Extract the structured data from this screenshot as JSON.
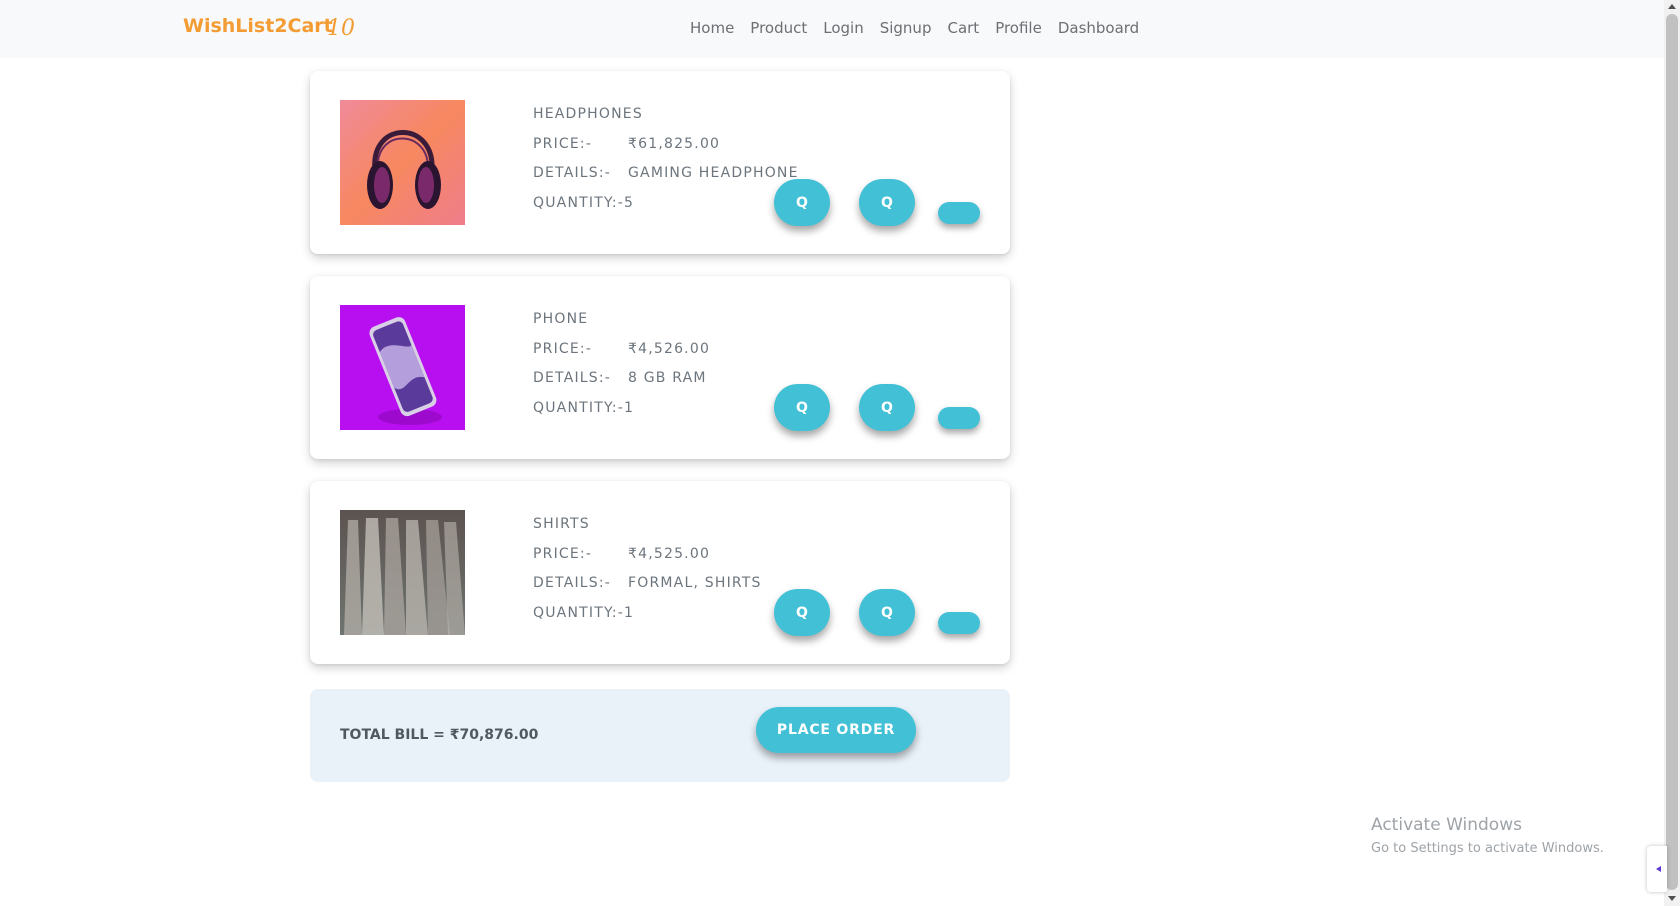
{
  "navbar": {
    "brand": "WishList2Cart",
    "cart_count": "10",
    "links": [
      "Home",
      "Product",
      "Login",
      "Signup",
      "Cart",
      "Profile",
      "Dashboard"
    ]
  },
  "cart": {
    "items": [
      {
        "name": "HEADPHONES",
        "price_label": "PRICE:-",
        "price": "₹61,825.00",
        "details_label": "DETAILS:-",
        "details": "GAMING HEADPHONE",
        "quantity": "QUANTITY:-5",
        "image": "headphones-photo",
        "dec_label": "Q",
        "inc_label": "Q"
      },
      {
        "name": "PHONE",
        "price_label": "PRICE:-",
        "price": "₹4,526.00",
        "details_label": "DETAILS:-",
        "details": "8 GB RAM",
        "quantity": "QUANTITY:-1",
        "image": "phone-photo",
        "dec_label": "Q",
        "inc_label": "Q"
      },
      {
        "name": "SHIRTS",
        "price_label": "PRICE:-",
        "price": "₹4,525.00",
        "details_label": "DETAILS:-",
        "details": "FORMAL, SHIRTS",
        "quantity": "QUANTITY:-1",
        "image": "shirts-photo",
        "dec_label": "Q",
        "inc_label": "Q"
      }
    ],
    "total": "TOTAL BILL = ₹70,876.00",
    "place_order": "PLACE ORDER"
  },
  "watermark": {
    "title": "Activate Windows",
    "subtitle": "Go to Settings to activate Windows."
  },
  "colors": {
    "brand": "#f39c34",
    "accent": "#42c0d6",
    "total_bg": "#e9f1f9"
  }
}
